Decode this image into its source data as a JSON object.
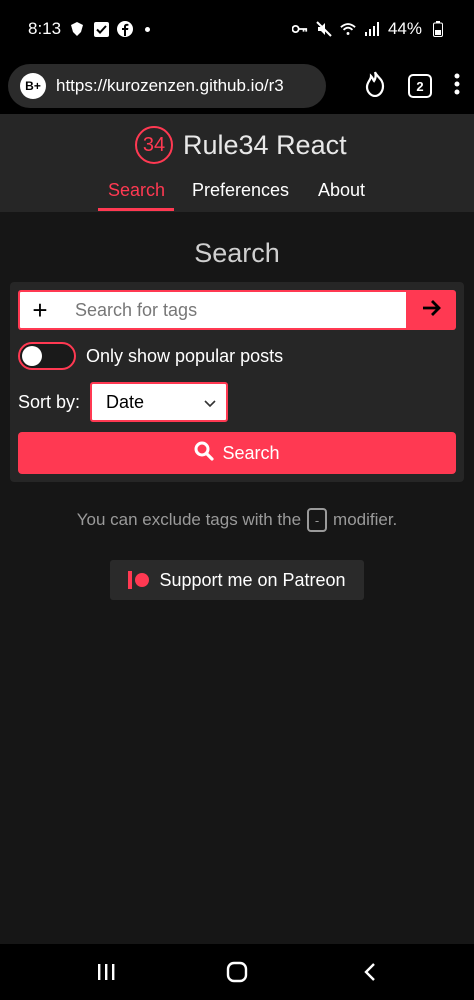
{
  "status_bar": {
    "time": "8:13",
    "battery": "44%",
    "left_icons": [
      "shield-icon",
      "check-icon",
      "facebook-icon",
      "dot-icon"
    ],
    "right_icons": [
      "key-icon",
      "mute-icon",
      "wifi-icon",
      "signal-icon",
      "battery-icon"
    ]
  },
  "browser": {
    "url": "https://kurozenzen.github.io/r3",
    "tab_count": "2",
    "badge": "B+"
  },
  "site": {
    "logo_text": "34",
    "title": "Rule34 React",
    "nav": [
      {
        "label": "Search",
        "active": true
      },
      {
        "label": "Preferences",
        "active": false
      },
      {
        "label": "About",
        "active": false
      }
    ]
  },
  "main": {
    "heading": "Search",
    "tag_input_placeholder": "Search for tags",
    "toggle_label": "Only show popular posts",
    "toggle_on": false,
    "sort_label": "Sort by:",
    "sort_value": "Date",
    "search_button": "Search",
    "hint_before": "You can exclude tags with the",
    "hint_key": "-",
    "hint_after": "modifier.",
    "patreon_button": "Support me on Patreon"
  },
  "colors": {
    "accent": "#ff3952",
    "background": "#161616",
    "header": "#262626"
  }
}
